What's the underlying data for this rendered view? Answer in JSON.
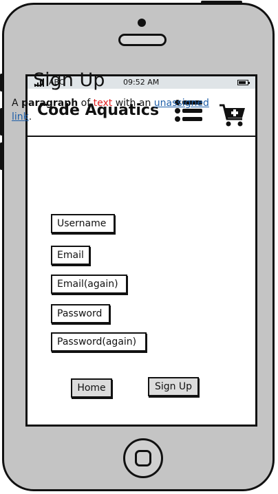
{
  "status_bar": {
    "carrier": "ABC",
    "time": "09:52 AM"
  },
  "header": {
    "brand": "Code Aquatics",
    "menu_icon": "hamburger-list-icon",
    "cart_icon": "cart-add-icon"
  },
  "main": {
    "title": "Sign Up",
    "paragraph": {
      "part1": "A ",
      "bold": "paragraph",
      "part2": " of ",
      "red": "text",
      "part3": " with an ",
      "link": "unassigned link",
      "part4": "."
    },
    "fields": {
      "username": "Username",
      "email": "Email",
      "email_again": "Email(again)",
      "password": "Password",
      "password_again": "Password(again)"
    },
    "buttons": {
      "home": "Home",
      "signup": "Sign Up"
    }
  },
  "colors": {
    "red_text": "#e02020",
    "link": "#1d5ea8",
    "status_bar": "#dfe4e7",
    "button_bg": "#dcdcdc",
    "phone_body": "#c4c4c4"
  }
}
